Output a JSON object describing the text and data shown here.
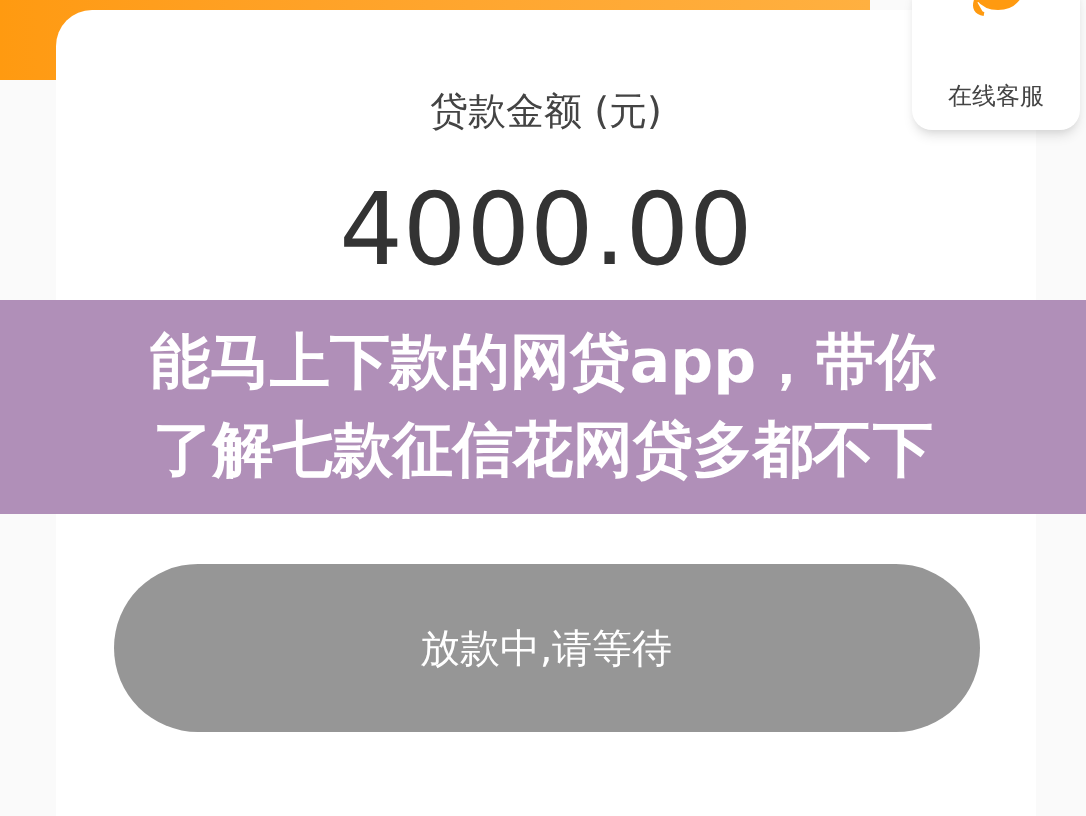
{
  "amount_card": {
    "label": "贷款金额 (元)",
    "amount": "4000.00"
  },
  "customer_service": {
    "label": "在线客服"
  },
  "status_button": {
    "label": "放款中,请等待",
    "disabled": true
  },
  "title_banner": {
    "lines": [
      "能马上下款的网贷app，带你",
      "了解七款征信花网贷多都不下"
    ]
  }
}
